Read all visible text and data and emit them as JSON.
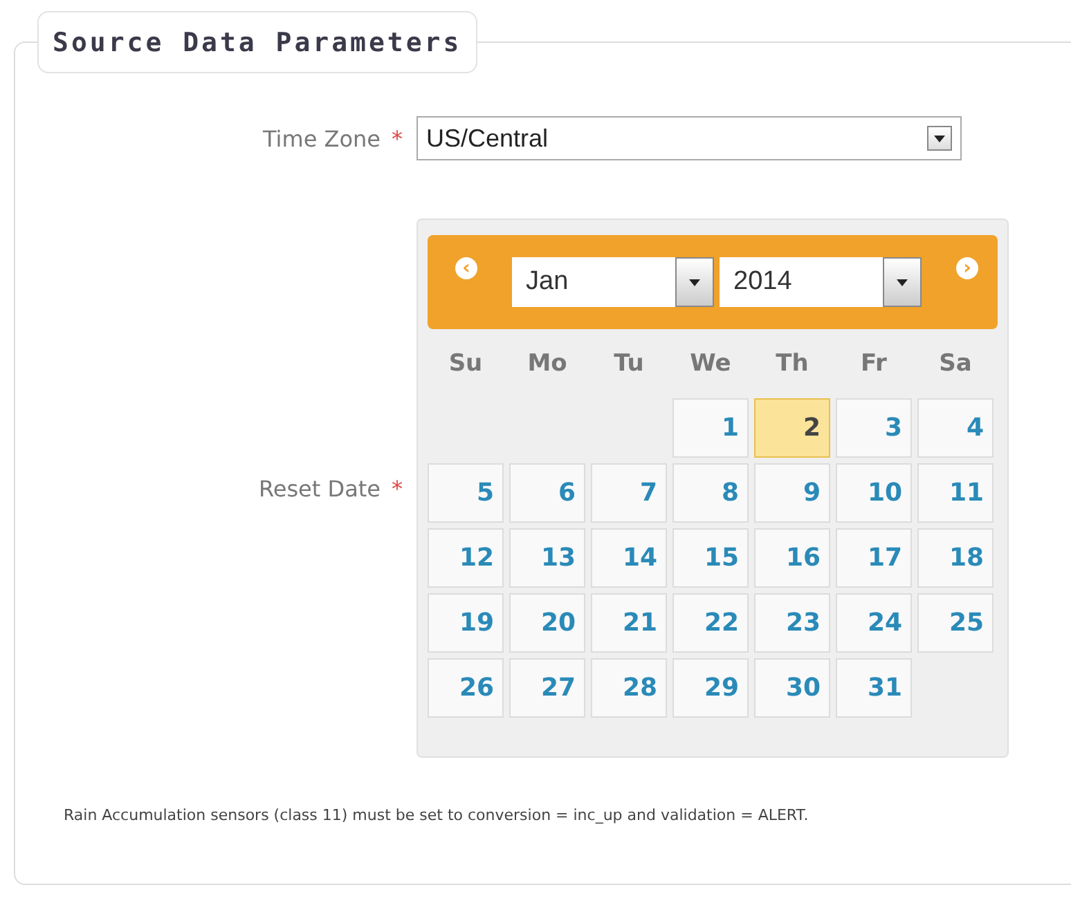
{
  "section": {
    "title": "Source Data Parameters"
  },
  "time_zone": {
    "label": "Time Zone",
    "required_mark": "*",
    "value": "US/Central"
  },
  "reset_date": {
    "label": "Reset Date",
    "required_mark": "*",
    "calendar": {
      "prev_icon": "‹",
      "next_icon": "›",
      "month": "Jan",
      "year": "2014",
      "weekdays": [
        "Su",
        "Mo",
        "Tu",
        "We",
        "Th",
        "Fr",
        "Sa"
      ],
      "weeks": [
        [
          {
            "kind": "blank"
          },
          {
            "kind": "blank"
          },
          {
            "kind": "blank"
          },
          {
            "kind": "day",
            "label": "1",
            "selected": false
          },
          {
            "kind": "day",
            "label": "2",
            "selected": true
          },
          {
            "kind": "day",
            "label": "3",
            "selected": false
          },
          {
            "kind": "day",
            "label": "4",
            "selected": false
          }
        ],
        [
          {
            "kind": "day",
            "label": "5",
            "selected": false
          },
          {
            "kind": "day",
            "label": "6",
            "selected": false
          },
          {
            "kind": "day",
            "label": "7",
            "selected": false
          },
          {
            "kind": "day",
            "label": "8",
            "selected": false
          },
          {
            "kind": "day",
            "label": "9",
            "selected": false
          },
          {
            "kind": "day",
            "label": "10",
            "selected": false
          },
          {
            "kind": "day",
            "label": "11",
            "selected": false
          }
        ],
        [
          {
            "kind": "day",
            "label": "12",
            "selected": false
          },
          {
            "kind": "day",
            "label": "13",
            "selected": false
          },
          {
            "kind": "day",
            "label": "14",
            "selected": false
          },
          {
            "kind": "day",
            "label": "15",
            "selected": false
          },
          {
            "kind": "day",
            "label": "16",
            "selected": false
          },
          {
            "kind": "day",
            "label": "17",
            "selected": false
          },
          {
            "kind": "day",
            "label": "18",
            "selected": false
          }
        ],
        [
          {
            "kind": "day",
            "label": "19",
            "selected": false
          },
          {
            "kind": "day",
            "label": "20",
            "selected": false
          },
          {
            "kind": "day",
            "label": "21",
            "selected": false
          },
          {
            "kind": "day",
            "label": "22",
            "selected": false
          },
          {
            "kind": "day",
            "label": "23",
            "selected": false
          },
          {
            "kind": "day",
            "label": "24",
            "selected": false
          },
          {
            "kind": "day",
            "label": "25",
            "selected": false
          }
        ],
        [
          {
            "kind": "day",
            "label": "26",
            "selected": false
          },
          {
            "kind": "day",
            "label": "27",
            "selected": false
          },
          {
            "kind": "day",
            "label": "28",
            "selected": false
          },
          {
            "kind": "day",
            "label": "29",
            "selected": false
          },
          {
            "kind": "day",
            "label": "30",
            "selected": false
          },
          {
            "kind": "day",
            "label": "31",
            "selected": false
          },
          {
            "kind": "blank"
          }
        ]
      ]
    }
  },
  "note": "Rain Accumulation sensors (class 11) must be set to conversion = inc_up and validation = ALERT."
}
